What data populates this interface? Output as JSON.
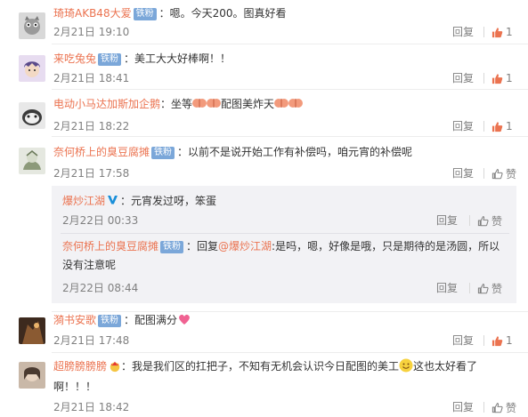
{
  "badge_label": "铁粉",
  "reply_label": "回复",
  "like_label": "赞",
  "comments": [
    {
      "name": "琦琦AKB48大爱",
      "text": "：嗯。今天200。图真好看",
      "time": "2月21日 19:10",
      "likes": "1",
      "liked": true
    },
    {
      "name": "来吃兔兔",
      "text": "：美工大大好棒啊！！",
      "time": "2月21日 18:41",
      "likes": "1",
      "liked": true
    },
    {
      "name": "电动小马达加斯加企鹅",
      "text_before": "：坐等",
      "text_after": "配图美炸天",
      "time": "2月21日 18:22",
      "likes": "1",
      "liked": true
    },
    {
      "name": "奈何桥上的臭豆腐摊",
      "text": "：以前不是说开始工作有补偿吗，咱元宵的补偿呢",
      "time": "2月21日 17:58",
      "likes": "",
      "liked": false
    },
    {
      "name": "漪书安歌",
      "text": "：配图满分",
      "time": "2月21日 17:48",
      "likes": "1",
      "liked": true
    },
    {
      "name": "超膀膀膀膀",
      "text_a": "：我是我们区的扛把子，不知有无机会认识今日配图的美工",
      "text_b": "这也太好看了",
      "text_c": "啊！！！",
      "time": "2月21日 18:42",
      "likes": "",
      "liked": false
    }
  ],
  "replies": [
    {
      "name": "爆炒江湖",
      "text": "：元宵发过呀，笨蛋",
      "time": "2月22日 00:33"
    },
    {
      "name": "奈何桥上的臭豆腐摊",
      "text_pre": "：回复",
      "mention": "@爆炒江湖",
      "text_a": ":是吗，嗯，好像是哦，只是期待的是汤圆，所以",
      "text_b": "没有注意呢",
      "time": "2月22日 08:44"
    }
  ],
  "colors": {
    "name": "#eb7350",
    "badge": "#7ba7d9",
    "liked": "#eb7350",
    "meta": "#808080"
  }
}
